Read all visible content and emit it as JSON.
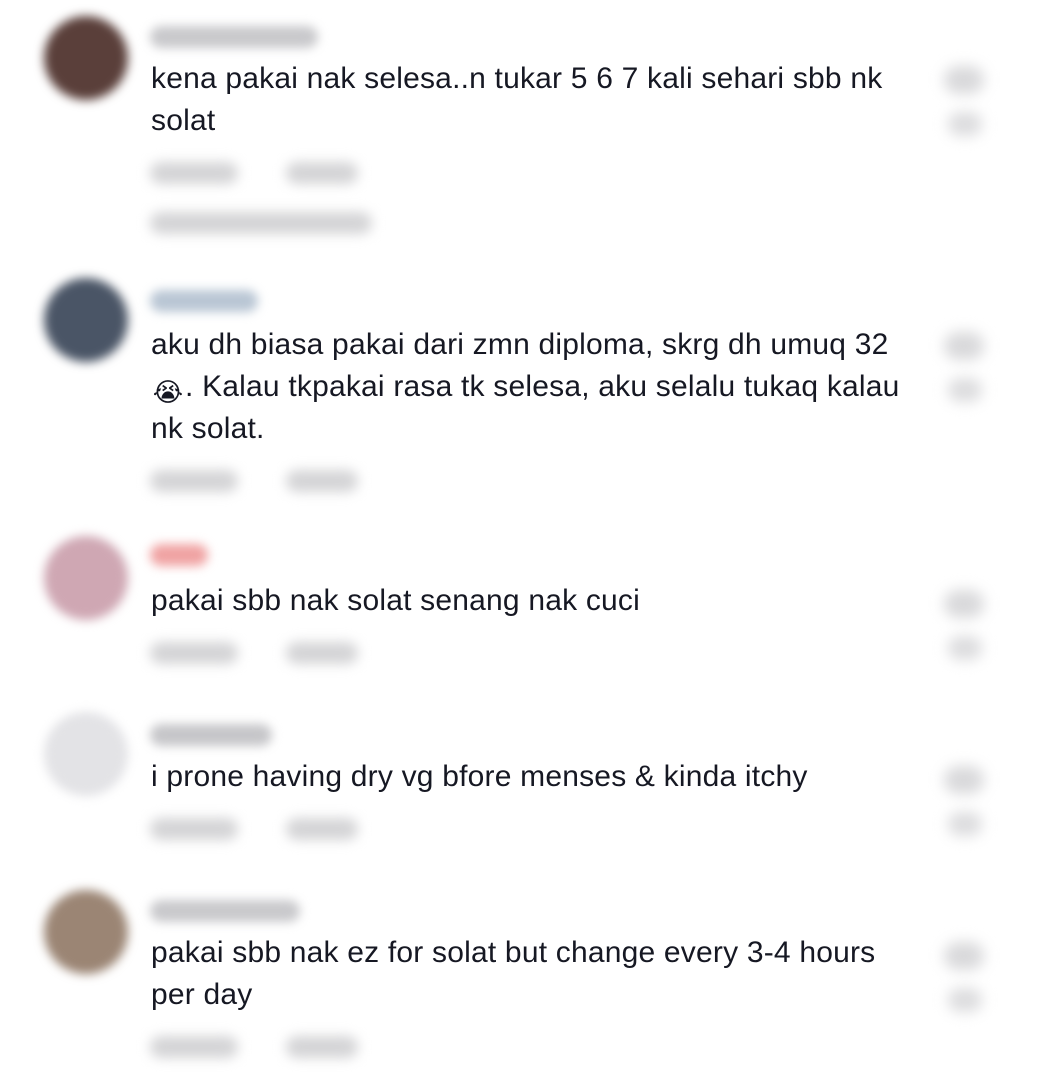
{
  "comments": [
    {
      "text": "kena pakai nak selesa..n tukar 5 6 7 kali sehari sbb nk solat",
      "avatar_color": "#5a3f3a",
      "username_color": "#c9c9cc"
    },
    {
      "text_before_emoji": "aku dh biasa pakai dari zmn diploma, skrg dh umuq 32",
      "emoji": "😭",
      "text_after_emoji": ". Kalau tkpakai rasa tk selesa, aku selalu tukaq kalau nk solat.",
      "avatar_color": "#4a5566",
      "username_color": "#b9c6d4"
    },
    {
      "text": "pakai sbb nak solat senang nak cuci",
      "avatar_color": "#cfa7b3",
      "username_color": "#f0a3a3"
    },
    {
      "text": "i prone having dry vg bfore menses & kinda itchy",
      "avatar_color": "#e3e3e6",
      "username_color": "#c6c6c9"
    },
    {
      "text": "pakai sbb nak ez for solat but change every 3-4 hours per day",
      "avatar_color": "#9b8574",
      "username_color": "#c9c9cc"
    }
  ]
}
